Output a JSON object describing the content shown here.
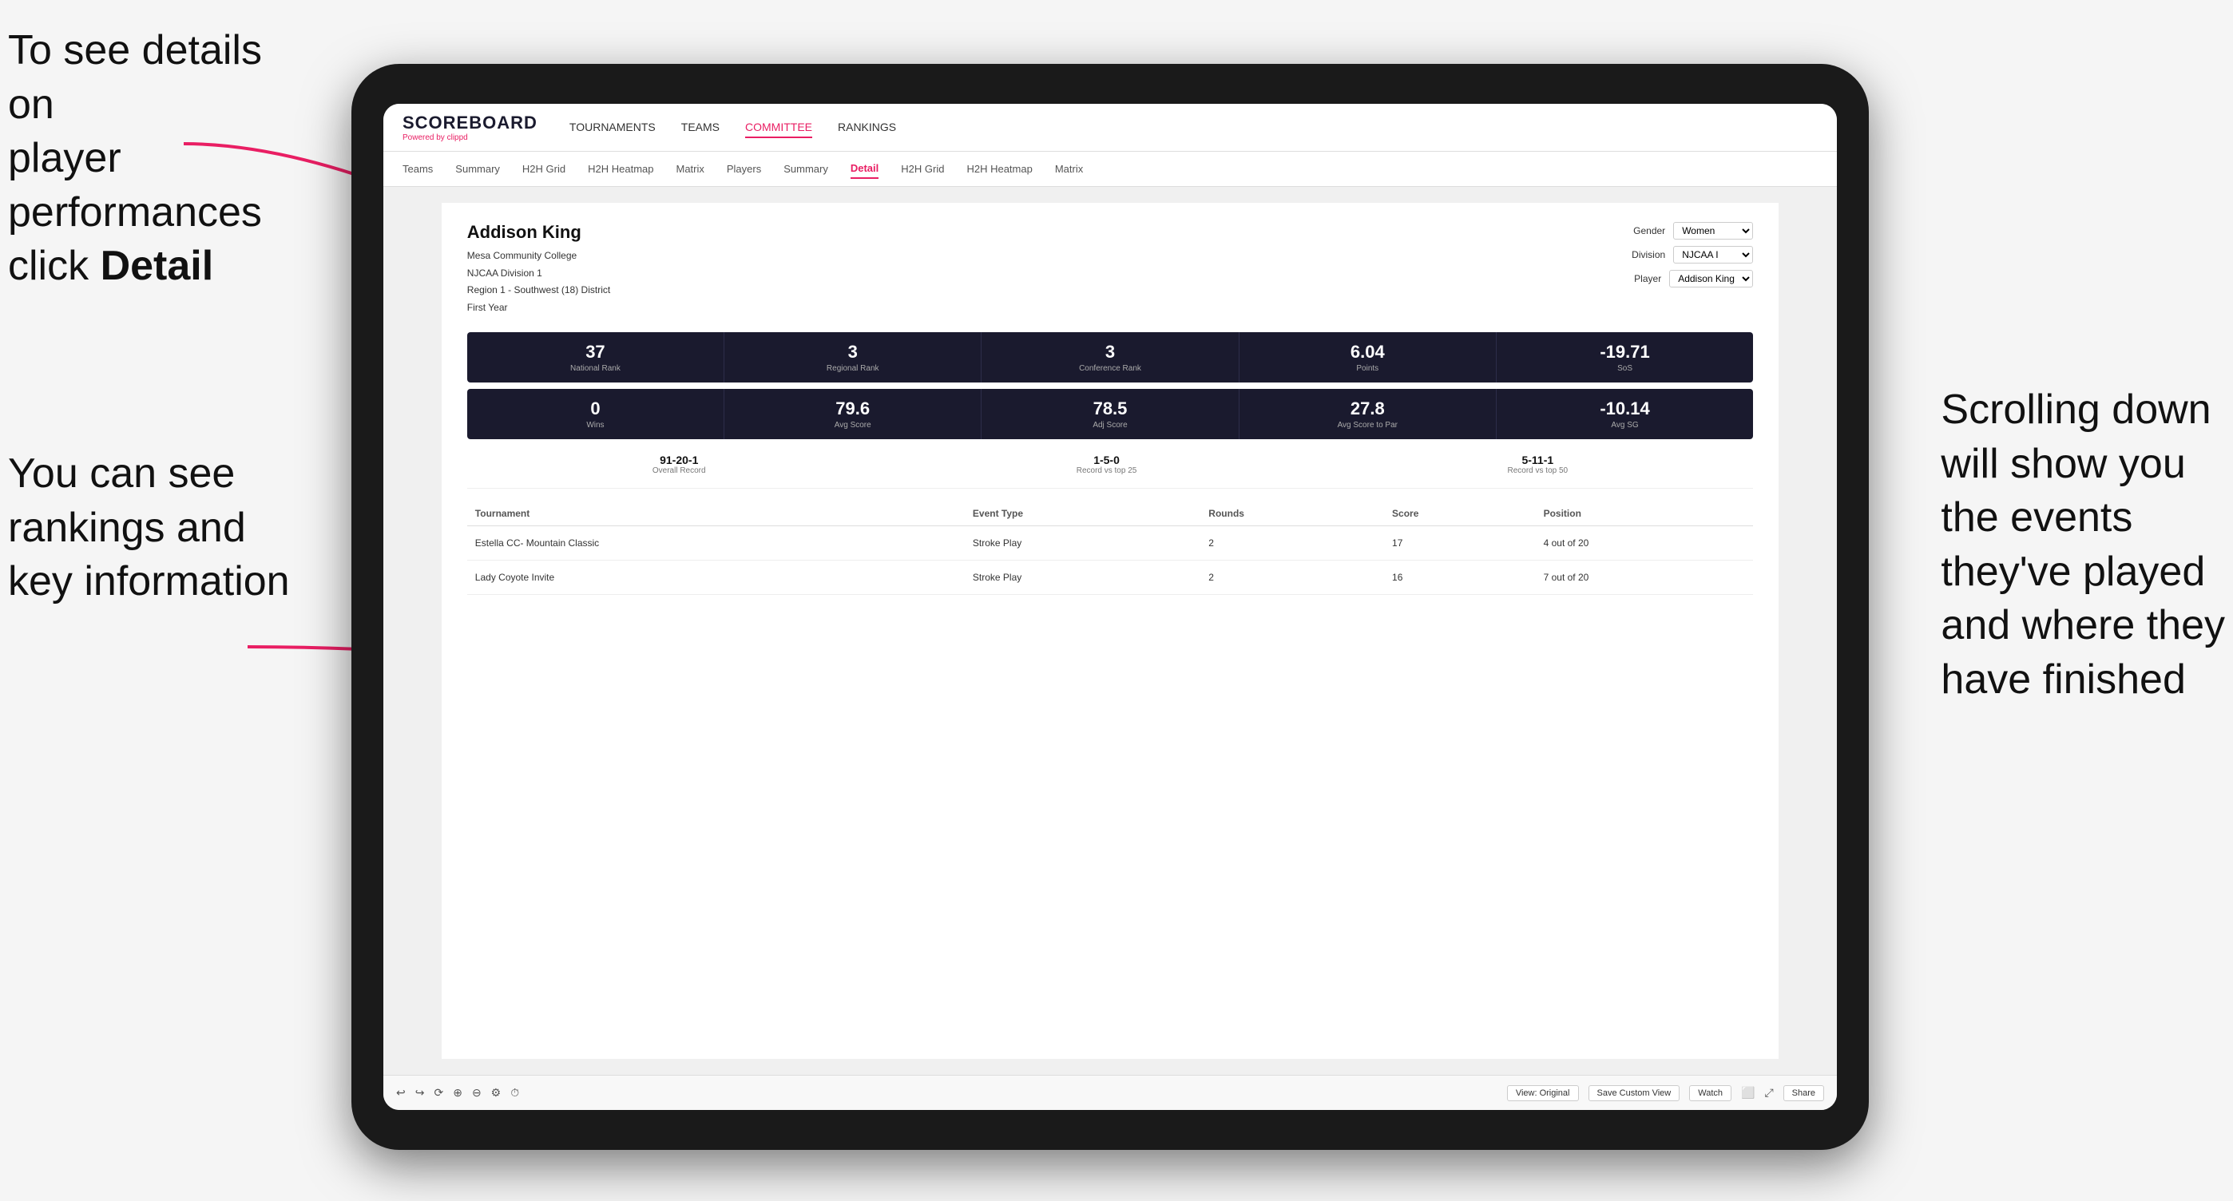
{
  "annotations": {
    "topleft_line1": "To see details on",
    "topleft_line2": "player performances",
    "topleft_line3_prefix": "click ",
    "topleft_line3_bold": "Detail",
    "bottomleft_line1": "You can see",
    "bottomleft_line2": "rankings and",
    "bottomleft_line3": "key information",
    "right_line1": "Scrolling down",
    "right_line2": "will show you",
    "right_line3": "the events",
    "right_line4": "they've played",
    "right_line5": "and where they",
    "right_line6": "have finished"
  },
  "nav": {
    "logo": "SCOREBOARD",
    "powered_by": "Powered by ",
    "brand": "clippd",
    "items": [
      "TOURNAMENTS",
      "TEAMS",
      "COMMITTEE",
      "RANKINGS"
    ],
    "active_item": "COMMITTEE"
  },
  "sub_nav": {
    "items": [
      "Teams",
      "Summary",
      "H2H Grid",
      "H2H Heatmap",
      "Matrix",
      "Players",
      "Summary",
      "Detail",
      "H2H Grid",
      "H2H Heatmap",
      "Matrix"
    ],
    "active_item": "Detail"
  },
  "player": {
    "name": "Addison King",
    "school": "Mesa Community College",
    "division": "NJCAA Division 1",
    "region": "Region 1 - Southwest (18) District",
    "year": "First Year"
  },
  "selectors": {
    "gender_label": "Gender",
    "gender_value": "Women",
    "division_label": "Division",
    "division_value": "NJCAA I",
    "player_label": "Player",
    "player_value": "Addison King"
  },
  "stats_row1": [
    {
      "value": "37",
      "label": "National Rank"
    },
    {
      "value": "3",
      "label": "Regional Rank"
    },
    {
      "value": "3",
      "label": "Conference Rank"
    },
    {
      "value": "6.04",
      "label": "Points"
    },
    {
      "value": "-19.71",
      "label": "SoS"
    }
  ],
  "stats_row2": [
    {
      "value": "0",
      "label": "Wins"
    },
    {
      "value": "79.6",
      "label": "Avg Score"
    },
    {
      "value": "78.5",
      "label": "Adj Score"
    },
    {
      "value": "27.8",
      "label": "Avg Score to Par"
    },
    {
      "value": "-10.14",
      "label": "Avg SG"
    }
  ],
  "records": [
    {
      "value": "91-20-1",
      "label": "Overall Record"
    },
    {
      "value": "1-5-0",
      "label": "Record vs top 25"
    },
    {
      "value": "5-11-1",
      "label": "Record vs top 50"
    }
  ],
  "table": {
    "headers": [
      "Tournament",
      "Event Type",
      "Rounds",
      "Score",
      "Position"
    ],
    "rows": [
      {
        "tournament": "Estella CC- Mountain Classic",
        "event_type": "Stroke Play",
        "rounds": "2",
        "score": "17",
        "position": "4 out of 20"
      },
      {
        "tournament": "Lady Coyote Invite",
        "event_type": "Stroke Play",
        "rounds": "2",
        "score": "16",
        "position": "7 out of 20"
      }
    ]
  },
  "toolbar": {
    "view_label": "View: Original",
    "save_label": "Save Custom View",
    "watch_label": "Watch",
    "share_label": "Share"
  }
}
